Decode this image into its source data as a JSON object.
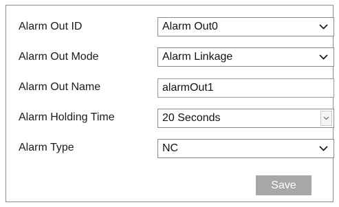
{
  "form": {
    "alarm_out_id": {
      "label": "Alarm Out ID",
      "value": "Alarm Out0"
    },
    "alarm_out_mode": {
      "label": "Alarm Out Mode",
      "value": "Alarm Linkage"
    },
    "alarm_out_name": {
      "label": "Alarm Out Name",
      "value": "alarmOut1"
    },
    "alarm_holding_time": {
      "label": "Alarm Holding Time",
      "value": "20 Seconds"
    },
    "alarm_type": {
      "label": "Alarm Type",
      "value": "NC"
    }
  },
  "save_label": "Save",
  "icons": {
    "dropdown": "chevron-down-icon"
  },
  "colors": {
    "save_button_bg": "#a7a7a7",
    "save_button_text": "#ffffff",
    "field_border": "#8a8a8a"
  }
}
